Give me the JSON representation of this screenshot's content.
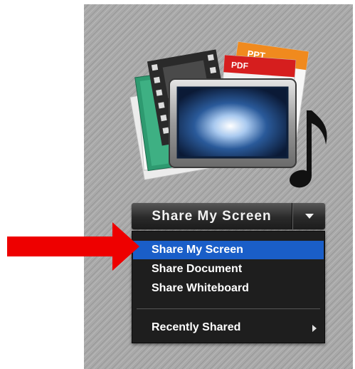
{
  "share_button": {
    "label": "Share My Screen",
    "dropdown_icon": "triangle-down-icon"
  },
  "share_menu": {
    "items": [
      {
        "label": "Share My Screen",
        "selected": true
      },
      {
        "label": "Share Document",
        "selected": false
      },
      {
        "label": "Share Whiteboard",
        "selected": false
      }
    ],
    "recent": {
      "label": "Recently Shared",
      "submenu_icon": "triangle-right-icon"
    }
  },
  "hero_icons": {
    "ppt_tag": "PPT",
    "pdf_tag": "PDF",
    "icons": [
      "film-strip-icon",
      "ppt-document-icon",
      "pdf-document-icon",
      "monitor-screen-icon",
      "music-note-icon"
    ]
  },
  "annotation": {
    "icon": "red-arrow-icon",
    "color": "#ee0000"
  },
  "colors": {
    "menu_bg": "#1e1e1e",
    "selected_bg": "#1a5ec8",
    "panel_bg": "#a9a9a9"
  }
}
